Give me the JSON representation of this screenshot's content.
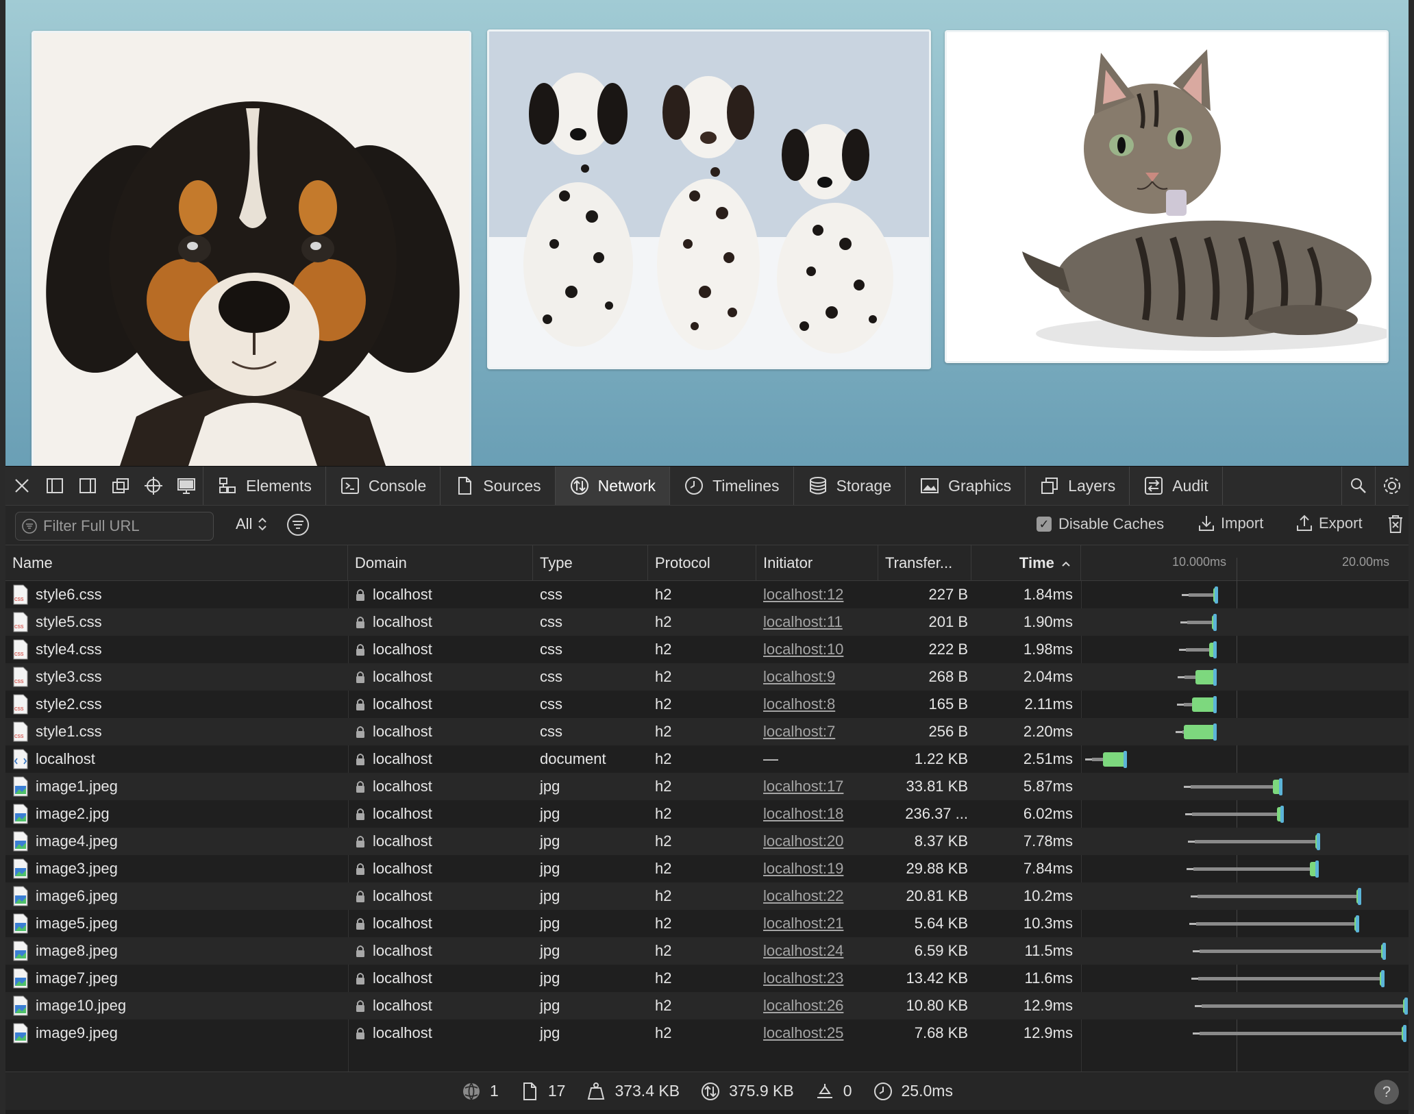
{
  "toolbar": {
    "tabs": [
      {
        "label": "Elements",
        "icon": "elements-icon"
      },
      {
        "label": "Console",
        "icon": "console-icon"
      },
      {
        "label": "Sources",
        "icon": "sources-icon"
      },
      {
        "label": "Network",
        "icon": "network-icon",
        "active": true
      },
      {
        "label": "Timelines",
        "icon": "timelines-icon"
      },
      {
        "label": "Storage",
        "icon": "storage-icon"
      },
      {
        "label": "Graphics",
        "icon": "graphics-icon"
      },
      {
        "label": "Layers",
        "icon": "layers-icon"
      },
      {
        "label": "Audit",
        "icon": "audit-icon"
      }
    ]
  },
  "filter": {
    "placeholder": "Filter Full URL",
    "type_filter": "All",
    "disable_caches_label": "Disable Caches",
    "disable_caches_checked": true,
    "import_label": "Import",
    "export_label": "Export"
  },
  "columns": {
    "name": "Name",
    "domain": "Domain",
    "type": "Type",
    "protocol": "Protocol",
    "initiator": "Initiator",
    "transfer": "Transfer...",
    "time": "Time"
  },
  "waterfall": {
    "tick1": "10.000ms",
    "tick2": "20.00ms"
  },
  "rows": [
    {
      "name": "style6.css",
      "kind": "css",
      "domain": "localhost",
      "type": "css",
      "protocol": "h2",
      "initiator": "localhost:12",
      "transfer": "227 B",
      "time": "1.84ms"
    },
    {
      "name": "style5.css",
      "kind": "css",
      "domain": "localhost",
      "type": "css",
      "protocol": "h2",
      "initiator": "localhost:11",
      "transfer": "201 B",
      "time": "1.90ms"
    },
    {
      "name": "style4.css",
      "kind": "css",
      "domain": "localhost",
      "type": "css",
      "protocol": "h2",
      "initiator": "localhost:10",
      "transfer": "222 B",
      "time": "1.98ms"
    },
    {
      "name": "style3.css",
      "kind": "css",
      "domain": "localhost",
      "type": "css",
      "protocol": "h2",
      "initiator": "localhost:9",
      "transfer": "268 B",
      "time": "2.04ms"
    },
    {
      "name": "style2.css",
      "kind": "css",
      "domain": "localhost",
      "type": "css",
      "protocol": "h2",
      "initiator": "localhost:8",
      "transfer": "165 B",
      "time": "2.11ms"
    },
    {
      "name": "style1.css",
      "kind": "css",
      "domain": "localhost",
      "type": "css",
      "protocol": "h2",
      "initiator": "localhost:7",
      "transfer": "256 B",
      "time": "2.20ms"
    },
    {
      "name": "localhost",
      "kind": "doc",
      "domain": "localhost",
      "type": "document",
      "protocol": "h2",
      "initiator": "—",
      "transfer": "1.22 KB",
      "time": "2.51ms"
    },
    {
      "name": "image1.jpeg",
      "kind": "img",
      "domain": "localhost",
      "type": "jpg",
      "protocol": "h2",
      "initiator": "localhost:17",
      "transfer": "33.81 KB",
      "time": "5.87ms"
    },
    {
      "name": "image2.jpg",
      "kind": "img",
      "domain": "localhost",
      "type": "jpg",
      "protocol": "h2",
      "initiator": "localhost:18",
      "transfer": "236.37 ...",
      "time": "6.02ms"
    },
    {
      "name": "image4.jpeg",
      "kind": "img",
      "domain": "localhost",
      "type": "jpg",
      "protocol": "h2",
      "initiator": "localhost:20",
      "transfer": "8.37 KB",
      "time": "7.78ms"
    },
    {
      "name": "image3.jpeg",
      "kind": "img",
      "domain": "localhost",
      "type": "jpg",
      "protocol": "h2",
      "initiator": "localhost:19",
      "transfer": "29.88 KB",
      "time": "7.84ms"
    },
    {
      "name": "image6.jpeg",
      "kind": "img",
      "domain": "localhost",
      "type": "jpg",
      "protocol": "h2",
      "initiator": "localhost:22",
      "transfer": "20.81 KB",
      "time": "10.2ms"
    },
    {
      "name": "image5.jpeg",
      "kind": "img",
      "domain": "localhost",
      "type": "jpg",
      "protocol": "h2",
      "initiator": "localhost:21",
      "transfer": "5.64 KB",
      "time": "10.3ms"
    },
    {
      "name": "image8.jpeg",
      "kind": "img",
      "domain": "localhost",
      "type": "jpg",
      "protocol": "h2",
      "initiator": "localhost:24",
      "transfer": "6.59 KB",
      "time": "11.5ms"
    },
    {
      "name": "image7.jpeg",
      "kind": "img",
      "domain": "localhost",
      "type": "jpg",
      "protocol": "h2",
      "initiator": "localhost:23",
      "transfer": "13.42 KB",
      "time": "11.6ms"
    },
    {
      "name": "image10.jpeg",
      "kind": "img",
      "domain": "localhost",
      "type": "jpg",
      "protocol": "h2",
      "initiator": "localhost:26",
      "transfer": "10.80 KB",
      "time": "12.9ms"
    },
    {
      "name": "image9.jpeg",
      "kind": "img",
      "domain": "localhost",
      "type": "jpg",
      "protocol": "h2",
      "initiator": "localhost:25",
      "transfer": "7.68 KB",
      "time": "12.9ms"
    }
  ],
  "status": {
    "domains": "1",
    "resources": "17",
    "size": "373.4 KB",
    "transferred": "375.9 KB",
    "redirects": "0",
    "time": "25.0ms",
    "help": "?"
  },
  "colors": {
    "active_tab": "#3a3a3a",
    "waterfall_receive": "#7dd87e",
    "waterfall_end": "#5bb4d8"
  }
}
